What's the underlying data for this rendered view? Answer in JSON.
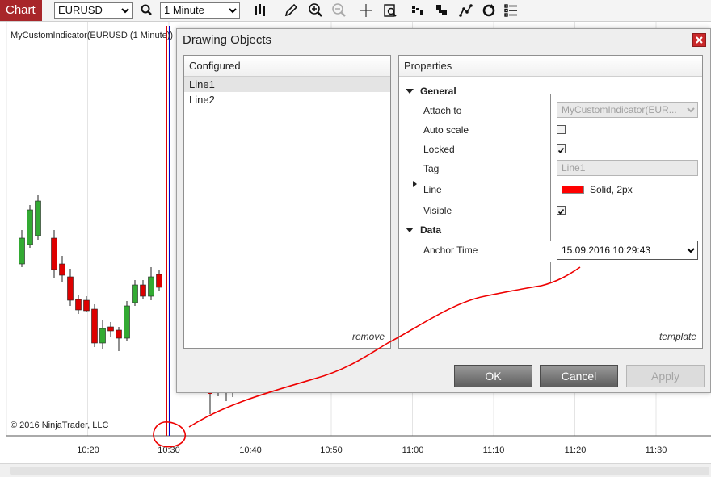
{
  "toolbar": {
    "chart_tab_label": "Chart",
    "instrument": "EURUSD",
    "interval": "1 Minute",
    "icons": [
      "search-icon",
      "bar-type-icon",
      "pencil-icon",
      "zoom-in-icon",
      "zoom-out-icon",
      "crosshair-icon",
      "data-box-icon",
      "indicators-icon",
      "strategies-icon",
      "drawing-tools-icon",
      "reload-icon",
      "properties-icon"
    ]
  },
  "chart": {
    "title": "MyCustomIndicator(EURUSD (1 Minute))",
    "copyright": "© 2016 NinjaTrader, LLC",
    "time_labels": [
      "10:20",
      "10:30",
      "10:40",
      "10:50",
      "11:00",
      "11:10",
      "11:20",
      "11:30"
    ],
    "colors": {
      "up_candle": "#33aa33",
      "down_candle": "#dd0000",
      "vertical_line_red": "#dd0000",
      "vertical_line_blue": "#0000cc"
    }
  },
  "dialog": {
    "title": "Drawing Objects",
    "configured": {
      "header": "Configured",
      "items": [
        "Line1",
        "Line2"
      ],
      "selected_index": 0,
      "remove_link": "remove"
    },
    "properties": {
      "header": "Properties",
      "general_group": "General",
      "attach_to_label": "Attach to",
      "attach_to_value": "MyCustomIndicator(EUR...",
      "auto_scale_label": "Auto scale",
      "auto_scale_checked": false,
      "locked_label": "Locked",
      "locked_checked": true,
      "tag_label": "Tag",
      "tag_value": "Line1",
      "line_label": "Line",
      "line_value": "Solid, 2px",
      "line_color": "#ff0000",
      "visible_label": "Visible",
      "visible_checked": true,
      "data_group": "Data",
      "anchor_time_label": "Anchor Time",
      "anchor_time_value": "15.09.2016 10:29:43",
      "template_link": "template"
    },
    "buttons": {
      "ok": "OK",
      "cancel": "Cancel",
      "apply": "Apply"
    }
  }
}
